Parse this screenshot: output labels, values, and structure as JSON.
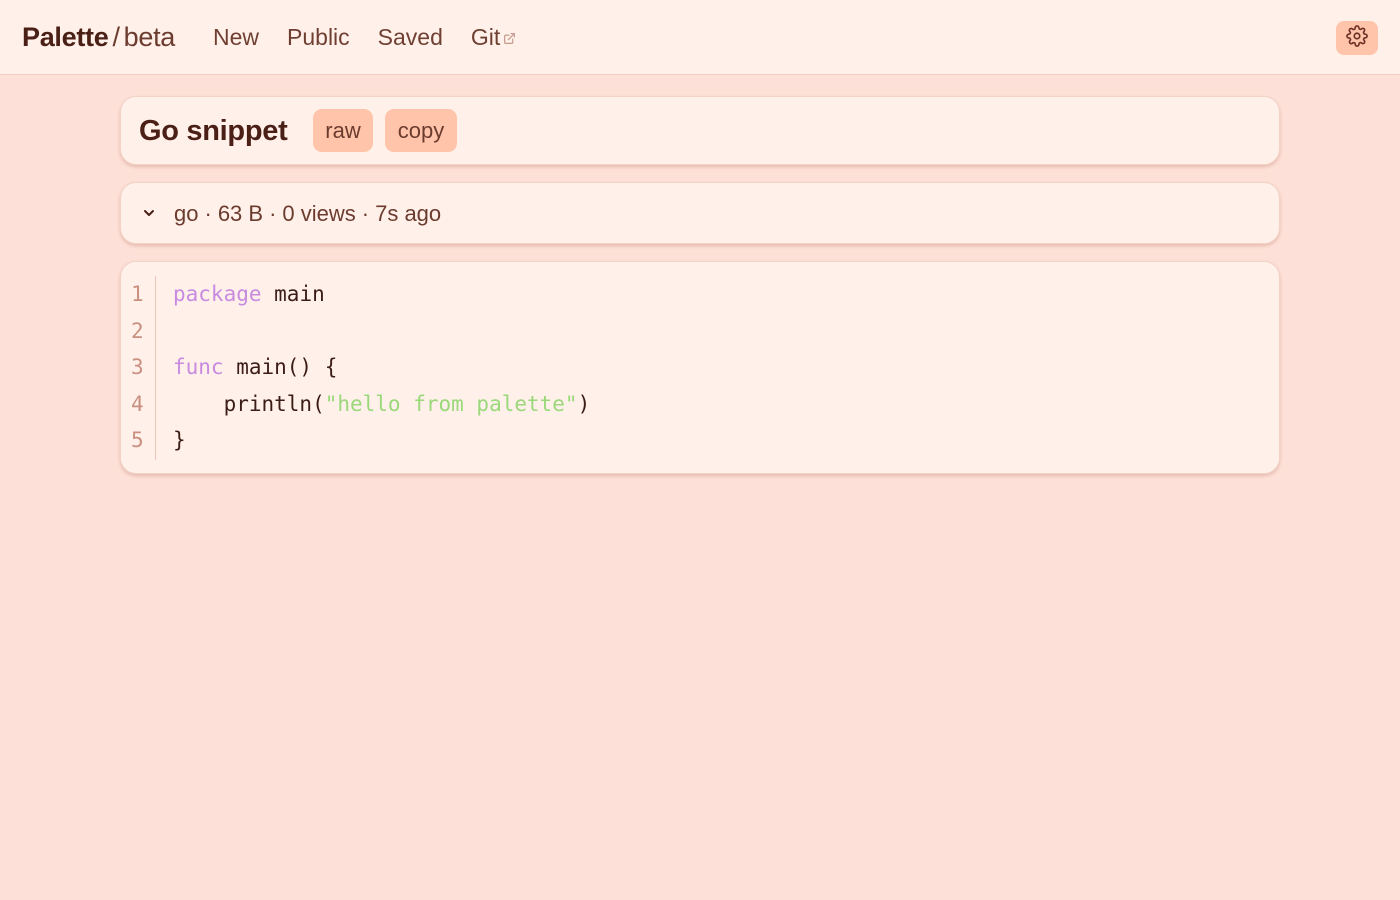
{
  "brand": {
    "name": "Palette",
    "separator": "/",
    "sub": "beta"
  },
  "nav": {
    "items": [
      {
        "label": "New"
      },
      {
        "label": "Public"
      },
      {
        "label": "Saved"
      },
      {
        "label": "Git",
        "icon": "external-link-icon"
      }
    ]
  },
  "settings": {
    "icon": "gear-icon"
  },
  "snippet": {
    "title": "Go snippet",
    "raw_label": "raw",
    "copy_label": "copy"
  },
  "meta": {
    "icon": "chevron-down-icon",
    "language": "go",
    "size": "63 B",
    "views": "0 views",
    "age": "7s ago",
    "separator": "·"
  },
  "code": {
    "line_numbers": [
      "1",
      "2",
      "3",
      "4",
      "5"
    ],
    "lines": [
      {
        "kw": "package",
        "rest": " main"
      },
      {
        "text": ""
      },
      {
        "kw": "func",
        "rest": " main() {"
      },
      {
        "pre": "    println(",
        "str": "\"hello from palette\"",
        "post": ")"
      },
      {
        "text": "}"
      }
    ]
  },
  "colors": {
    "background": "#fde0d7",
    "surface": "#fff0ea",
    "accent": "#ffc4aa",
    "keyword": "#c88be0",
    "string": "#9ad87a",
    "text": "#4a1f15"
  }
}
